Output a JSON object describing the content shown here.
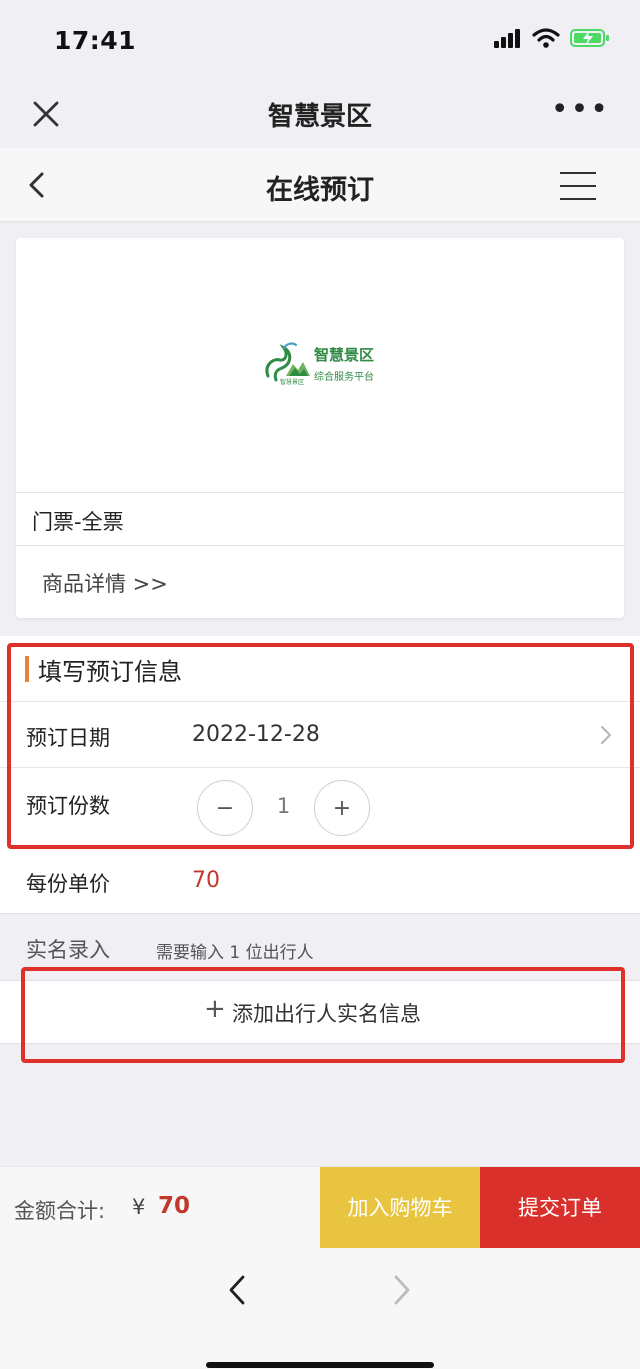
{
  "status_bar": {
    "time": "17:41",
    "icons": [
      "signal-icon",
      "wifi-icon",
      "battery-charging-icon"
    ],
    "battery_color": "#4cd964"
  },
  "wechat_nav": {
    "title": "智慧景区",
    "close_icon": "close-icon",
    "more_icon": "more-icon"
  },
  "app_header": {
    "title": "在线预订",
    "back_icon": "chevron-left-icon",
    "menu_icon": "hamburger-menu-icon"
  },
  "product": {
    "logo": {
      "name": "智慧景区",
      "subtitle": "综合服务平台",
      "tiny_text": "智慧景区"
    },
    "name": "门票-全票",
    "detail_link": "商品详情 >>"
  },
  "booking_form": {
    "title": "填写预订信息",
    "date_label": "预订日期",
    "date_value": "2022-12-28",
    "quantity_label": "预订份数",
    "quantity_value": "1",
    "minus_label": "−",
    "plus_label": "+",
    "price_label": "每份单价",
    "price_value": "70"
  },
  "realname": {
    "label": "实名录入",
    "hint": "需要输入 1 位出行人",
    "add_plus": "+",
    "add_label": "添加出行人实名信息"
  },
  "bottom_bar": {
    "total_label": "金额合计:",
    "currency": "¥",
    "total_value": "70",
    "cart_button": "加入购物车",
    "submit_button": "提交订单"
  },
  "colors": {
    "accent_orange": "#e8823a",
    "price_red": "#c0392b",
    "cart_yellow": "#e8c440",
    "submit_red": "#d9302c",
    "highlight_red": "#e0302b",
    "logo_green": "#2f8a44"
  }
}
